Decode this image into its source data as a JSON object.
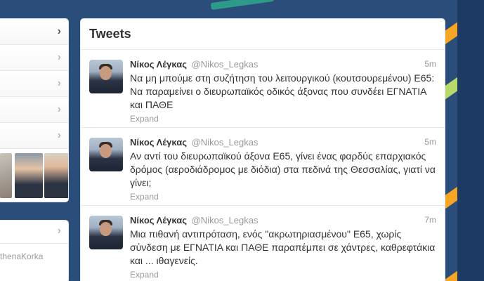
{
  "tweets_panel": {
    "title": "Tweets",
    "items": [
      {
        "name": "Νίκος Λέγκας",
        "handle": "@Nikos_Legkas",
        "time": "5m",
        "text": "Να μη μπούμε στη συζήτηση του λειτουργικού (κουτσουρεμένου) Ε65: Να παραμείνει ο διευρωπαϊκός οδικός άξονας που συνδέει ΕΓΝΑΤΙΑ και ΠΑΘΕ",
        "expand": "Expand"
      },
      {
        "name": "Νίκος Λέγκας",
        "handle": "@Nikos_Legkas",
        "time": "5m",
        "text": "Αν αντί του διευρωπαϊκού άξονα Ε65, γίνει ένας φαρδύς επαρχιακός δρόμος (αεροδιάδρομος με διόδια) στα πεδινά της Θεσσαλίας, γιατί να γίνει;",
        "expand": "Expand"
      },
      {
        "name": "Νίκος Λέγκας",
        "handle": "@Nikos_Legkas",
        "time": "7m",
        "text": "Μια πιθανή αντιπρόταση, ενός \"ακρωτηριασμένου\" Ε65, χωρίς σύνδεση με ΕΓΝΑΤΙΑ και ΠΑΘΕ παραπέμπει σε χάντρες, καθρεφτάκια και ... ιθαγενείς.",
        "expand": "Expand"
      }
    ]
  },
  "left_column": {
    "lower_module_handle": "thenaKorka"
  },
  "icons": {
    "chevron": "chevron-right-icon"
  },
  "colors": {
    "background": "#2a4d7a",
    "accent_orange": "#f6a623",
    "accent_green": "#b7d86b"
  }
}
